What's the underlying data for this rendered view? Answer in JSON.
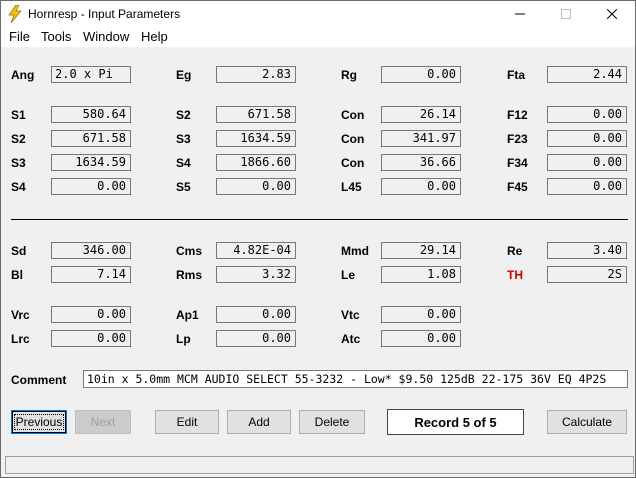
{
  "window": {
    "title": "Hornresp - Input Parameters"
  },
  "menu": [
    "File",
    "Tools",
    "Window",
    "Help"
  ],
  "fields": {
    "Ang": "2.0 x Pi",
    "Eg": "2.83",
    "Rg": "0.00",
    "Fta": "2.44",
    "S1": "580.64",
    "S2a": "671.58",
    "Con1": "26.14",
    "F12": "0.00",
    "S2b": "671.58",
    "S3a": "1634.59",
    "Con2": "341.97",
    "F23": "0.00",
    "S3b": "1634.59",
    "S4a": "1866.60",
    "Con3": "36.66",
    "F34": "0.00",
    "S4b": "0.00",
    "S5": "0.00",
    "L45": "0.00",
    "F45": "0.00",
    "Sd": "346.00",
    "Cms": "4.82E-04",
    "Mmd": "29.14",
    "Re": "3.40",
    "Bl": "7.14",
    "Rms": "3.32",
    "Le": "1.08",
    "TH": "2S",
    "Vrc": "0.00",
    "Ap1": "0.00",
    "Vtc": "0.00",
    "Lrc": "0.00",
    "Lp": "0.00",
    "Atc": "0.00"
  },
  "labels": {
    "Ang": "Ang",
    "Eg": "Eg",
    "Rg": "Rg",
    "Fta": "Fta",
    "S1": "S1",
    "S2": "S2",
    "Con": "Con",
    "F12": "F12",
    "S3": "S3",
    "F23": "F23",
    "S4": "S4",
    "F34": "F34",
    "S5": "S5",
    "L45": "L45",
    "F45": "F45",
    "Sd": "Sd",
    "Cms": "Cms",
    "Mmd": "Mmd",
    "Re": "Re",
    "Bl": "Bl",
    "Rms": "Rms",
    "Le": "Le",
    "TH": "TH",
    "Vrc": "Vrc",
    "Ap1": "Ap1",
    "Vtc": "Vtc",
    "Lrc": "Lrc",
    "Lp": "Lp",
    "Atc": "Atc",
    "Comment": "Comment"
  },
  "comment": "10in x 5.0mm MCM AUDIO SELECT 55-3232 - Low* $9.50 125dB 22-175 36V EQ 4P2S",
  "buttons": {
    "previous": "Previous",
    "next": "Next",
    "edit": "Edit",
    "add": "Add",
    "delete": "Delete",
    "calculate": "Calculate"
  },
  "record": "Record 5 of 5",
  "colors": {
    "th_label": "#d40000",
    "icon": "#f5c400"
  },
  "icons": {
    "app": "lightning-bolt-icon",
    "minimize": "minimize-icon",
    "maximize": "maximize-icon",
    "close": "close-icon"
  }
}
